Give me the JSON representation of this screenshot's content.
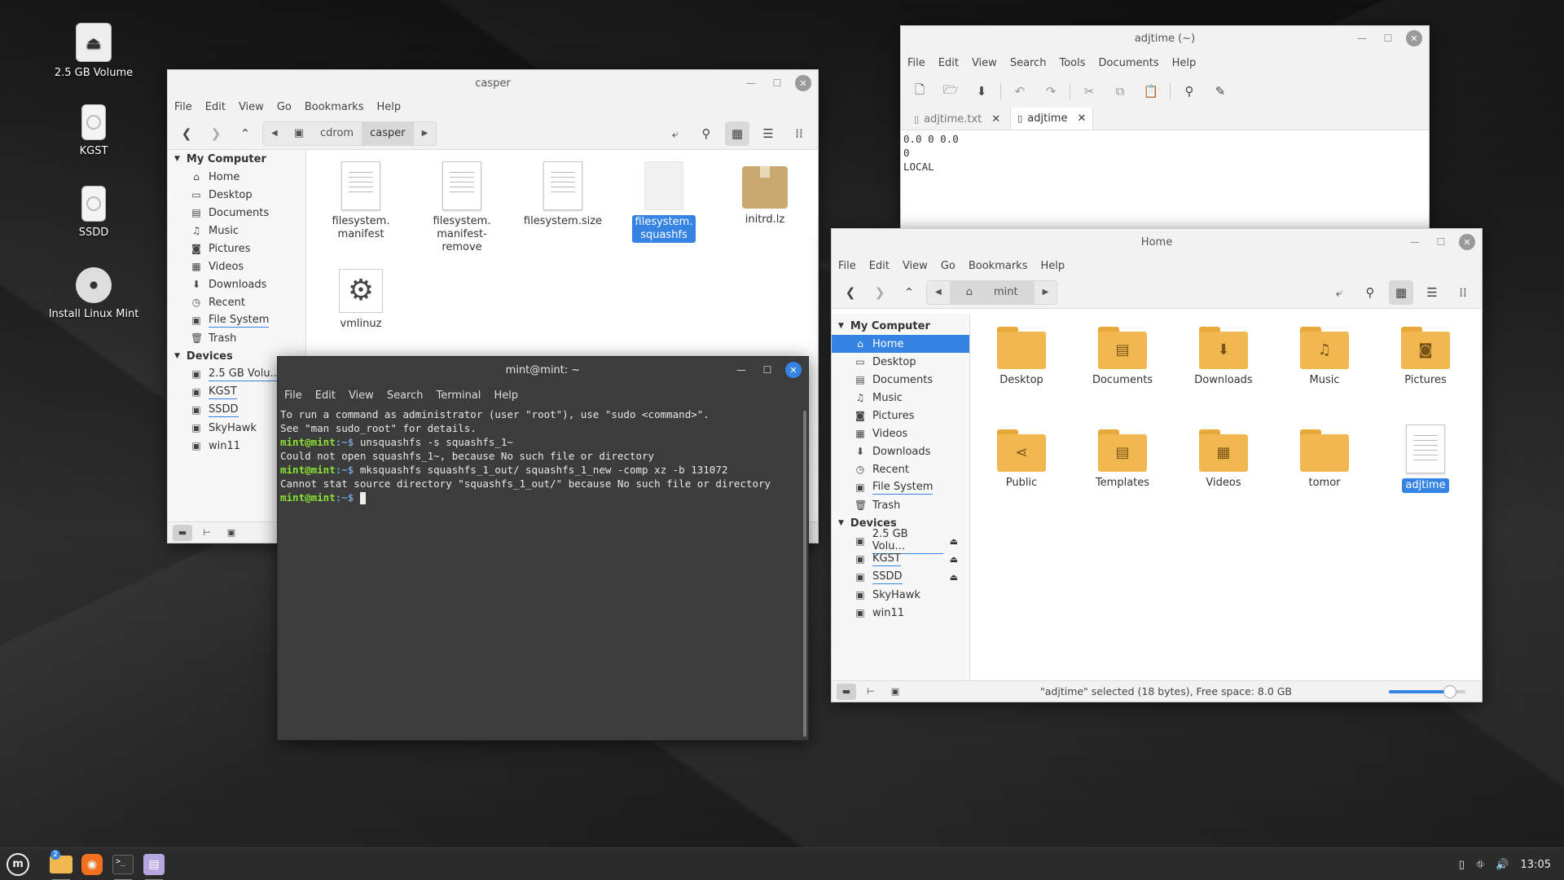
{
  "desktop": {
    "icons": [
      {
        "label": "2.5 GB Volume",
        "icon": "eject-drive-icon"
      },
      {
        "label": "KGST",
        "icon": "drive-icon"
      },
      {
        "label": "SSDD",
        "icon": "drive-icon"
      },
      {
        "label": "Install Linux Mint",
        "icon": "disc-icon"
      }
    ]
  },
  "casper_window": {
    "title": "casper",
    "menu": [
      "File",
      "Edit",
      "View",
      "Go",
      "Bookmarks",
      "Help"
    ],
    "breadcrumb": [
      "cdrom",
      "casper"
    ],
    "sidebar": {
      "section_computer": "My Computer",
      "computer_items": [
        "Home",
        "Desktop",
        "Documents",
        "Music",
        "Pictures",
        "Videos",
        "Downloads",
        "Recent",
        "File System",
        "Trash"
      ],
      "section_devices": "Devices",
      "device_items": [
        "2.5 GB Volu...",
        "KGST",
        "SSDD",
        "SkyHawk",
        "win11"
      ]
    },
    "files": [
      {
        "name": "filesystem.\nmanifest",
        "type": "text"
      },
      {
        "name": "filesystem.\nmanifest-remove",
        "type": "text"
      },
      {
        "name": "filesystem.size",
        "type": "text"
      },
      {
        "name": "filesystem.\nsquashfs",
        "type": "blank",
        "selected": true
      },
      {
        "name": "initrd.lz",
        "type": "archive"
      },
      {
        "name": "vmlinuz",
        "type": "executable"
      }
    ]
  },
  "editor_window": {
    "title": "adjtime (~)",
    "menu": [
      "File",
      "Edit",
      "View",
      "Search",
      "Tools",
      "Documents",
      "Help"
    ],
    "tabs": [
      {
        "label": "adjtime.txt"
      },
      {
        "label": "adjtime",
        "active": true
      }
    ],
    "content": [
      "0.0 0 0.0",
      "0",
      "LOCAL"
    ]
  },
  "home_window": {
    "title": "Home",
    "menu": [
      "File",
      "Edit",
      "View",
      "Go",
      "Bookmarks",
      "Help"
    ],
    "breadcrumb": [
      "mint"
    ],
    "sidebar": {
      "section_computer": "My Computer",
      "computer_items": [
        "Home",
        "Desktop",
        "Documents",
        "Music",
        "Pictures",
        "Videos",
        "Downloads",
        "Recent",
        "File System",
        "Trash"
      ],
      "section_devices": "Devices",
      "device_items": [
        "2.5 GB Volu...",
        "KGST",
        "SSDD",
        "SkyHawk",
        "win11"
      ]
    },
    "files": [
      {
        "name": "Desktop",
        "glyph": ""
      },
      {
        "name": "Documents",
        "glyph": "▤"
      },
      {
        "name": "Downloads",
        "glyph": "⬇"
      },
      {
        "name": "Music",
        "glyph": "♫"
      },
      {
        "name": "Pictures",
        "glyph": "◉"
      },
      {
        "name": "Public",
        "glyph": "⋖"
      },
      {
        "name": "Templates",
        "glyph": "▤"
      },
      {
        "name": "Videos",
        "glyph": "▦"
      },
      {
        "name": "tomor",
        "glyph": ""
      },
      {
        "name": "adjtime",
        "glyph": "doc",
        "selected": true
      }
    ],
    "status": "\"adjtime\" selected (18 bytes), Free space: 8.0 GB",
    "zoom_level": 0.8
  },
  "terminal_window": {
    "title": "mint@mint: ~",
    "menu": [
      "File",
      "Edit",
      "View",
      "Search",
      "Terminal",
      "Help"
    ],
    "lines": [
      {
        "text": "To run a command as administrator (user \"root\"), use \"sudo <command>\"."
      },
      {
        "text": "See \"man sudo_root\" for details."
      },
      {
        "text": ""
      },
      {
        "prompt_user": "mint@mint",
        "prompt_path": ":~$",
        "text": " unsquashfs -s squashfs_1~"
      },
      {
        "text": "Could not open squashfs_1~, because No such file or directory"
      },
      {
        "prompt_user": "mint@mint",
        "prompt_path": ":~$",
        "text": " mksquashfs squashfs_1_out/ squashfs_1_new -comp xz -b 131072"
      },
      {
        "text": "Cannot stat source directory \"squashfs_1_out/\" because No such file or directory"
      },
      {
        "prompt_user": "mint@mint",
        "prompt_path": ":~$",
        "text": " ",
        "cursor": true
      }
    ]
  },
  "taskbar": {
    "badge": "2",
    "clock": "13:05"
  }
}
